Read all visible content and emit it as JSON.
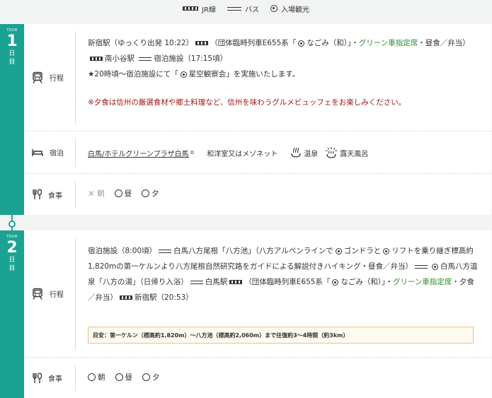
{
  "legend": {
    "jr": "JR線",
    "bus": "バス",
    "sight": "入場観光"
  },
  "days": [
    {
      "tour": "TOUR",
      "num": "1",
      "ch1": "日",
      "ch2": "目",
      "schedule_label": "行程",
      "itinerary": {
        "p1": "新宿駅（ゆっくり出発 10:22）",
        "p2": "（団体臨時列車E655系「",
        "p3": "なごみ（和）」・",
        "green": "グリーン車指定席",
        "p4": "・昼食／弁当）",
        "p5": "南小谷駅",
        "p6": "宿泊施設（17:15頃）",
        "line2": "★20時頃〜宿泊施設にて「",
        "line2b": "星空観察会」を実施いたします。",
        "note": "※夕食は信州の厳選食材や郷土料理など、信州を味わうグルメビュッフェをお楽しみください。"
      },
      "stay": {
        "label": "宿泊",
        "hotel": "白馬/ホテルグリーンプラザ白馬",
        "room": "和洋室又はメゾネット",
        "onsen": "温泉",
        "rotenburo": "露天風呂"
      },
      "meals": {
        "label": "食事",
        "breakfast": "朝",
        "lunch": "昼",
        "dinner": "夕"
      }
    },
    {
      "tour": "TOUR",
      "num": "2",
      "ch1": "日",
      "ch2": "目",
      "schedule_label": "行程",
      "itinerary": {
        "a1": "宿泊施設（8:00頃）",
        "a2": "白馬八方尾根「八方池」（八方アルペンラインで",
        "a3": "ゴンドラと",
        "a4": "リフトを乗り継ぎ標高約1,820mの第一ケルンより八方尾根自然研究路をガイドによる解説付きハイキング・昼食／弁当）",
        "a5": "白馬八方温泉「八方の湯」（日帰り入浴）",
        "a6": "白馬駅",
        "a7": "（団体臨時列車E655系「",
        "a8": "なごみ（和）」・",
        "green": "グリーン車指定席",
        "a9": "・夕食／弁当）",
        "a10": "新宿駅（20:53）"
      },
      "guide_note": "目安：第一ケルン（標高約1,820m）〜八方池（標高約2,060m）まで往復約3〜4時間（約3km）",
      "meals": {
        "label": "食事",
        "breakfast": "朝",
        "lunch": "昼",
        "dinner": "夕"
      }
    }
  ]
}
